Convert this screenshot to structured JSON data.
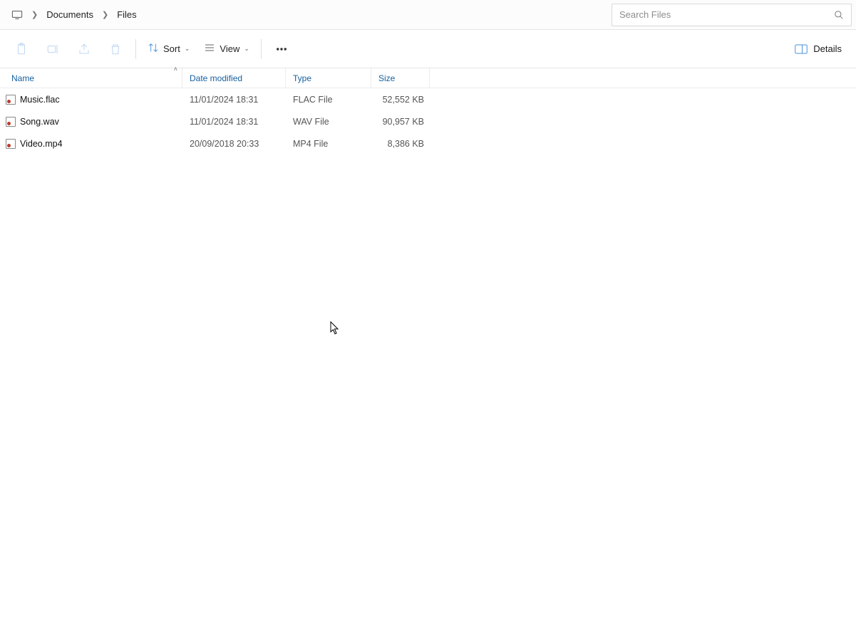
{
  "breadcrumbs": {
    "items": [
      "Documents",
      "Files"
    ]
  },
  "search": {
    "placeholder": "Search Files"
  },
  "toolbar": {
    "sort_label": "Sort",
    "view_label": "View",
    "details_label": "Details"
  },
  "columns": {
    "name": "Name",
    "date": "Date modified",
    "type": "Type",
    "size": "Size"
  },
  "files": [
    {
      "name": "Music.flac",
      "date": "11/01/2024 18:31",
      "type": "FLAC File",
      "size": "52,552 KB"
    },
    {
      "name": "Song.wav",
      "date": "11/01/2024 18:31",
      "type": "WAV File",
      "size": "90,957 KB"
    },
    {
      "name": "Video.mp4",
      "date": "20/09/2018 20:33",
      "type": "MP4 File",
      "size": "8,386 KB"
    }
  ]
}
